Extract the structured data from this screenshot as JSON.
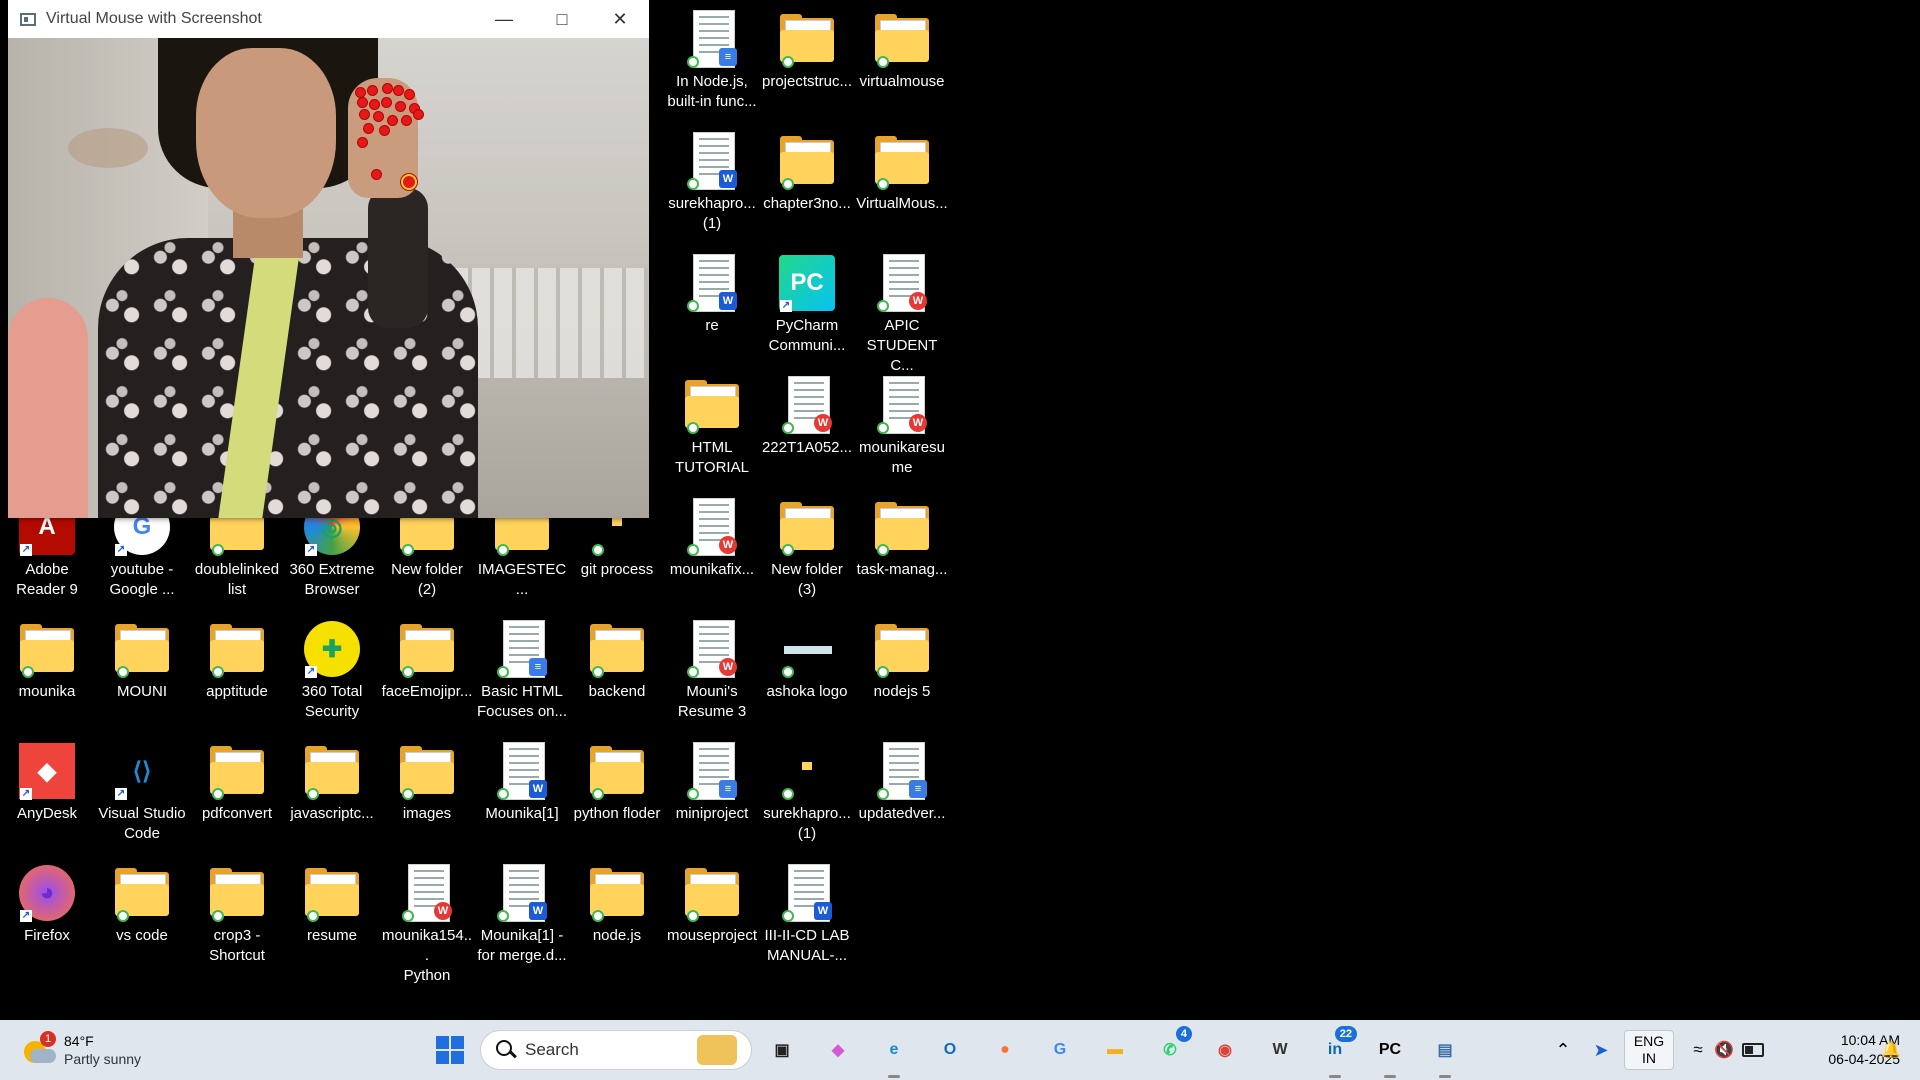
{
  "window": {
    "title": "Virtual Mouse with Screenshot"
  },
  "desktop": {
    "icons": [
      {
        "label": "In Node.js,\nbuilt-in func...",
        "kind": "doc-note"
      },
      {
        "label": "projectstruc...",
        "kind": "folder"
      },
      {
        "label": "virtualmouse",
        "kind": "folder"
      },
      {
        "label": "surekhapro...\n(1)",
        "kind": "doc-word"
      },
      {
        "label": "chapter3no...",
        "kind": "folder"
      },
      {
        "label": "VirtualMous...",
        "kind": "folder"
      },
      {
        "label": "re",
        "kind": "doc-word"
      },
      {
        "label": "PyCharm\nCommuni...",
        "kind": "app-pycharm"
      },
      {
        "label": "APIC\nSTUDENT C...",
        "kind": "doc-wps"
      },
      {
        "label": "HTML\nTUTORIAL",
        "kind": "folder"
      },
      {
        "label": "222T1A052...",
        "kind": "doc-wps"
      },
      {
        "label": "mounikaresu\nme",
        "kind": "doc-wps"
      },
      {
        "label": "Adobe\nReader 9",
        "kind": "app-adobe"
      },
      {
        "label": "youtube -\nGoogle ...",
        "kind": "app-google"
      },
      {
        "label": "doublelinked\nlist",
        "kind": "folder"
      },
      {
        "label": "360 Extreme\nBrowser",
        "kind": "app-360x"
      },
      {
        "label": "New folder\n(2)",
        "kind": "folder"
      },
      {
        "label": "IMAGESTEC...",
        "kind": "folder"
      },
      {
        "label": "git process",
        "kind": "folder-small"
      },
      {
        "label": "mounikafix...",
        "kind": "doc-wps"
      },
      {
        "label": "New folder\n(3)",
        "kind": "folder"
      },
      {
        "label": "task-manag...",
        "kind": "folder"
      },
      {
        "label": "mounika",
        "kind": "folder"
      },
      {
        "label": "MOUNI",
        "kind": "folder"
      },
      {
        "label": "apptitude",
        "kind": "folder"
      },
      {
        "label": "360 Total\nSecurity",
        "kind": "app-360ts"
      },
      {
        "label": "faceEmojipr...",
        "kind": "folder"
      },
      {
        "label": "Basic HTML\nFocuses on...",
        "kind": "doc-note"
      },
      {
        "label": "backend",
        "kind": "folder"
      },
      {
        "label": "Mouni's\nResume 3",
        "kind": "doc-wps"
      },
      {
        "label": "ashoka logo",
        "kind": "image"
      },
      {
        "label": "nodejs 5",
        "kind": "folder"
      },
      {
        "label": "AnyDesk",
        "kind": "app-anydesk"
      },
      {
        "label": "Visual Studio\nCode",
        "kind": "app-vscode"
      },
      {
        "label": "pdfconvert",
        "kind": "folder"
      },
      {
        "label": "javascriptc...",
        "kind": "folder"
      },
      {
        "label": "images",
        "kind": "folder"
      },
      {
        "label": "Mounika[1]",
        "kind": "doc-word"
      },
      {
        "label": "python floder",
        "kind": "folder"
      },
      {
        "label": "miniproject",
        "kind": "doc-note"
      },
      {
        "label": "surekhapro...\n(1)",
        "kind": "folder-small"
      },
      {
        "label": "updatedver...",
        "kind": "doc-note"
      },
      {
        "label": "Firefox",
        "kind": "app-firefox"
      },
      {
        "label": "vs code",
        "kind": "folder"
      },
      {
        "label": "crop3 -\nShortcut",
        "kind": "folder"
      },
      {
        "label": "resume",
        "kind": "folder"
      },
      {
        "label": "mounika154...\nPython",
        "kind": "doc-wps"
      },
      {
        "label": "Mounika[1] -\nfor merge.d...",
        "kind": "doc-word"
      },
      {
        "label": "node.js",
        "kind": "folder"
      },
      {
        "label": "mouseproject",
        "kind": "folder"
      },
      {
        "label": "III-II-CD LAB\nMANUAL-...",
        "kind": "doc-word"
      }
    ]
  },
  "taskbar": {
    "weather": {
      "temp": "84°F",
      "condition": "Partly sunny",
      "alert": "1"
    },
    "search_placeholder": "Search",
    "apps": [
      {
        "name": "start",
        "glyph": "⊞",
        "color": "#1f6fe0"
      },
      {
        "name": "task-view",
        "glyph": "▣",
        "color": "#222"
      },
      {
        "name": "copilot",
        "glyph": "◆",
        "color": "#d15ad1"
      },
      {
        "name": "edge",
        "glyph": "e",
        "color": "#1e88c7"
      },
      {
        "name": "outlook",
        "glyph": "O",
        "color": "#0f6cbd"
      },
      {
        "name": "firefox",
        "glyph": "●",
        "color": "#ff7139"
      },
      {
        "name": "google",
        "glyph": "G",
        "color": "#4285f4"
      },
      {
        "name": "file-explorer",
        "glyph": "▬",
        "color": "#f2b01e"
      },
      {
        "name": "whatsapp",
        "glyph": "✆",
        "color": "#25d366",
        "count": "4"
      },
      {
        "name": "chrome",
        "glyph": "◉",
        "color": "#db4437"
      },
      {
        "name": "wikipedia",
        "glyph": "W",
        "color": "#333"
      },
      {
        "name": "linkedin",
        "glyph": "in",
        "color": "#0a66c2",
        "count": "22"
      },
      {
        "name": "pycharm",
        "glyph": "PC",
        "color": "#000"
      },
      {
        "name": "python-app",
        "glyph": "▤",
        "color": "#3a6ea5"
      }
    ],
    "tray": {
      "language": "ENG",
      "region": "IN",
      "time": "10:04 AM",
      "date": "06-04-2025"
    }
  }
}
